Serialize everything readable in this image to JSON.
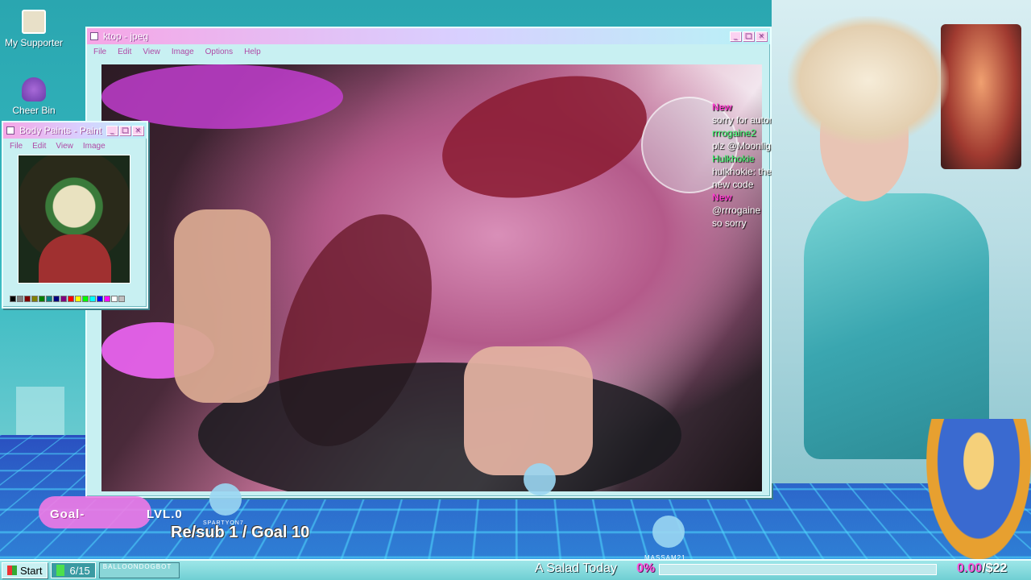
{
  "desktop": {
    "icons": [
      {
        "label": "My Supporter",
        "icon": "computer-icon"
      },
      {
        "label": "Cheer Bin",
        "icon": "trash-bin-icon"
      }
    ]
  },
  "main_window": {
    "title": "ktop - jpeg",
    "menu": [
      "File",
      "Edit",
      "View",
      "Image",
      "Options",
      "Help"
    ],
    "buttons": {
      "minimize": "_",
      "maximize": "□",
      "close": "×"
    }
  },
  "paint_window": {
    "title": "Body Paints - Paint",
    "menu": [
      "File",
      "Edit",
      "View",
      "Image"
    ],
    "buttons": {
      "minimize": "_",
      "maximize": "□",
      "close": "×"
    },
    "palette": [
      "#000000",
      "#808080",
      "#800000",
      "#808000",
      "#008000",
      "#008080",
      "#000080",
      "#800080",
      "#ff0000",
      "#ffff00",
      "#00ff00",
      "#00ffff",
      "#0000ff",
      "#ff00ff",
      "#ffffff",
      "#c0c0c0"
    ]
  },
  "chat": [
    {
      "user": "New",
      "text": "sorry for automod"
    },
    {
      "user": "rrrogaine2",
      "text": "plz @Moonlight..."
    },
    {
      "user": "Hulkhokie",
      "text": "hulkhokie: the grampy"
    },
    {
      "user": "",
      "text": "new code"
    },
    {
      "user": "New",
      "text": "@rrrogaine"
    },
    {
      "user": "",
      "text": "so sorry"
    }
  ],
  "overlays": {
    "goal_label": "Goal-",
    "level_label": "LVL.0",
    "sub_goal": "Re/sub 1 / Goal 10",
    "sub_name": "SPARTYON7",
    "massam": "MASSAM21"
  },
  "taskbar": {
    "start": "Start",
    "counter": "6/15",
    "bot": "BALLOONDOGBOT",
    "salad": "A Salad Today",
    "percent": "0%",
    "progress": 0,
    "money_current": "0.00",
    "money_goal": "/$22"
  },
  "colors": {
    "accent_pink": "#ff55dd",
    "teal": "#35b9c0",
    "title_gradient_start": "#f6a6e6"
  }
}
